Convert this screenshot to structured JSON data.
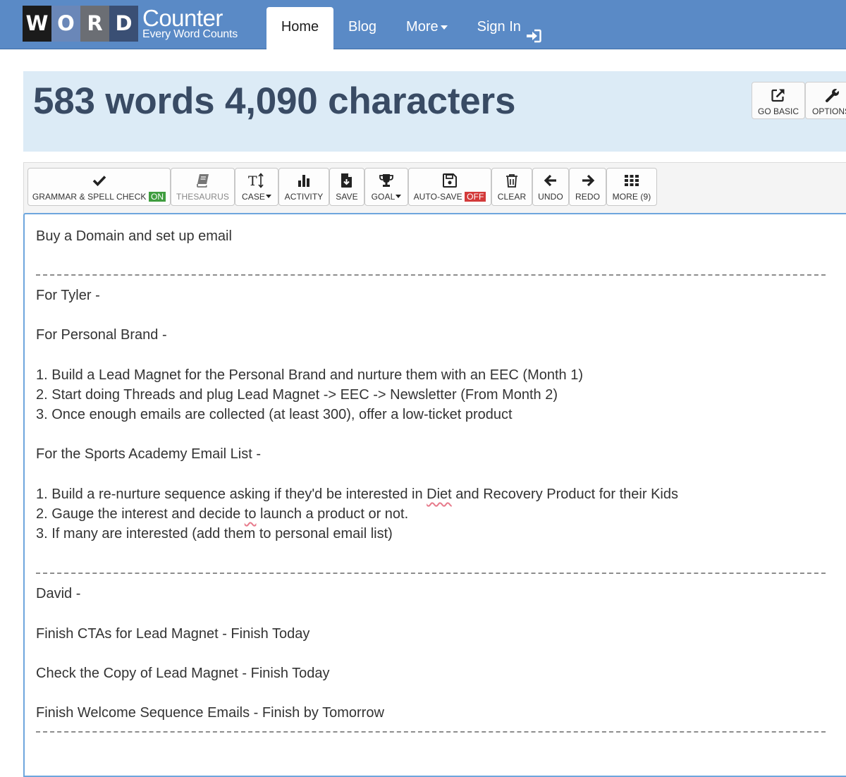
{
  "brand": {
    "letters": [
      "W",
      "O",
      "R",
      "D"
    ],
    "name": "Counter",
    "tagline": "Every Word Counts"
  },
  "nav": {
    "home": "Home",
    "blog": "Blog",
    "more": "More",
    "sign_in": "Sign In"
  },
  "counter": {
    "title": "583 words 4,090 characters",
    "go_basic": "GO BASIC",
    "options": "OPTIONS"
  },
  "toolbar": {
    "grammar": "GRAMMAR & SPELL CHECK",
    "grammar_state": "ON",
    "thesaurus": "THESAURUS",
    "case": "CASE",
    "activity": "ACTIVITY",
    "save": "SAVE",
    "goal": "GOAL",
    "autosave": "AUTO-SAVE",
    "autosave_state": "OFF",
    "clear": "CLEAR",
    "undo": "UNDO",
    "redo": "REDO",
    "more": "MORE (9)"
  },
  "editor": {
    "l0": "Buy a Domain and set up email",
    "l1": "For Tyler -",
    "l2": "For Personal Brand -",
    "l3": "1. Build a Lead Magnet for the Personal Brand and nurture them with an EEC (Month 1)",
    "l4": "2. Start doing Threads and plug Lead Magnet -> EEC -> Newsletter (From Month 2)",
    "l5": "3. Once enough emails are collected (at least 300), offer a low-ticket product",
    "l6": "For the Sports Academy Email List -",
    "l7a": "1. Build a re-nurture sequence asking if they'd be interested in ",
    "l7b": "Diet",
    "l7c": " and Recovery Product for their Kids",
    "l8a": "2. Gauge the interest and decide ",
    "l8b": "to",
    "l8c": " launch a product or not.",
    "l9": "3. If many are interested (add them to personal email list)",
    "l10": "David -",
    "l11": "Finish CTAs for Lead Magnet - Finish Today",
    "l12": "Check the Copy of Lead Magnet - Finish Today",
    "l13": "Finish Welcome Sequence Emails - Finish by Tomorrow"
  }
}
